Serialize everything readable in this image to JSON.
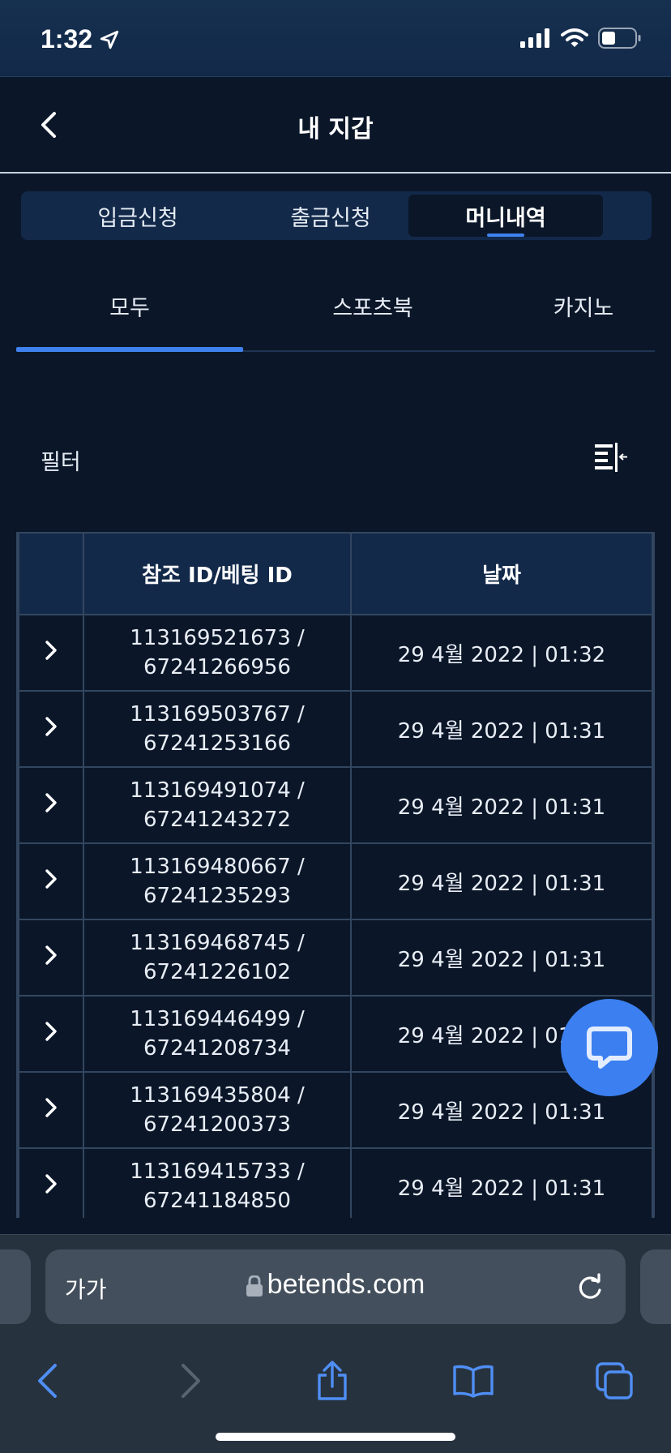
{
  "status_bar": {
    "time": "1:32"
  },
  "header": {
    "title": "내 지갑"
  },
  "segments": [
    {
      "label": "입금신청",
      "active": false
    },
    {
      "label": "출금신청",
      "active": false
    },
    {
      "label": "머니내역",
      "active": true
    }
  ],
  "subtabs": [
    {
      "label": "모두",
      "active": true
    },
    {
      "label": "스포츠북",
      "active": false
    },
    {
      "label": "카지노",
      "active": false
    }
  ],
  "filter": {
    "label": "필터"
  },
  "table": {
    "headers": [
      "",
      "참조 ID/베팅 ID",
      "날짜"
    ],
    "rows": [
      {
        "id_line1": "113169521673 /",
        "id_line2": "67241266956",
        "date": "29 4월 2022 | 01:32"
      },
      {
        "id_line1": "113169503767 /",
        "id_line2": "67241253166",
        "date": "29 4월 2022 | 01:31"
      },
      {
        "id_line1": "113169491074 /",
        "id_line2": "67241243272",
        "date": "29 4월 2022 | 01:31"
      },
      {
        "id_line1": "113169480667 /",
        "id_line2": "67241235293",
        "date": "29 4월 2022 | 01:31"
      },
      {
        "id_line1": "113169468745 /",
        "id_line2": "67241226102",
        "date": "29 4월 2022 | 01:31"
      },
      {
        "id_line1": "113169446499 /",
        "id_line2": "67241208734",
        "date": "29 4월 2022 | 01:31"
      },
      {
        "id_line1": "113169435804 /",
        "id_line2": "67241200373",
        "date": "29 4월 2022 | 01:31"
      },
      {
        "id_line1": "113169415733 /",
        "id_line2": "67241184850",
        "date": "29 4월 2022 | 01:31"
      }
    ]
  },
  "browser": {
    "text_size_label": "가가",
    "url": "betends.com"
  },
  "colors": {
    "accent": "#3f82ef",
    "background": "#0b1729",
    "header_bg": "#13294a"
  }
}
